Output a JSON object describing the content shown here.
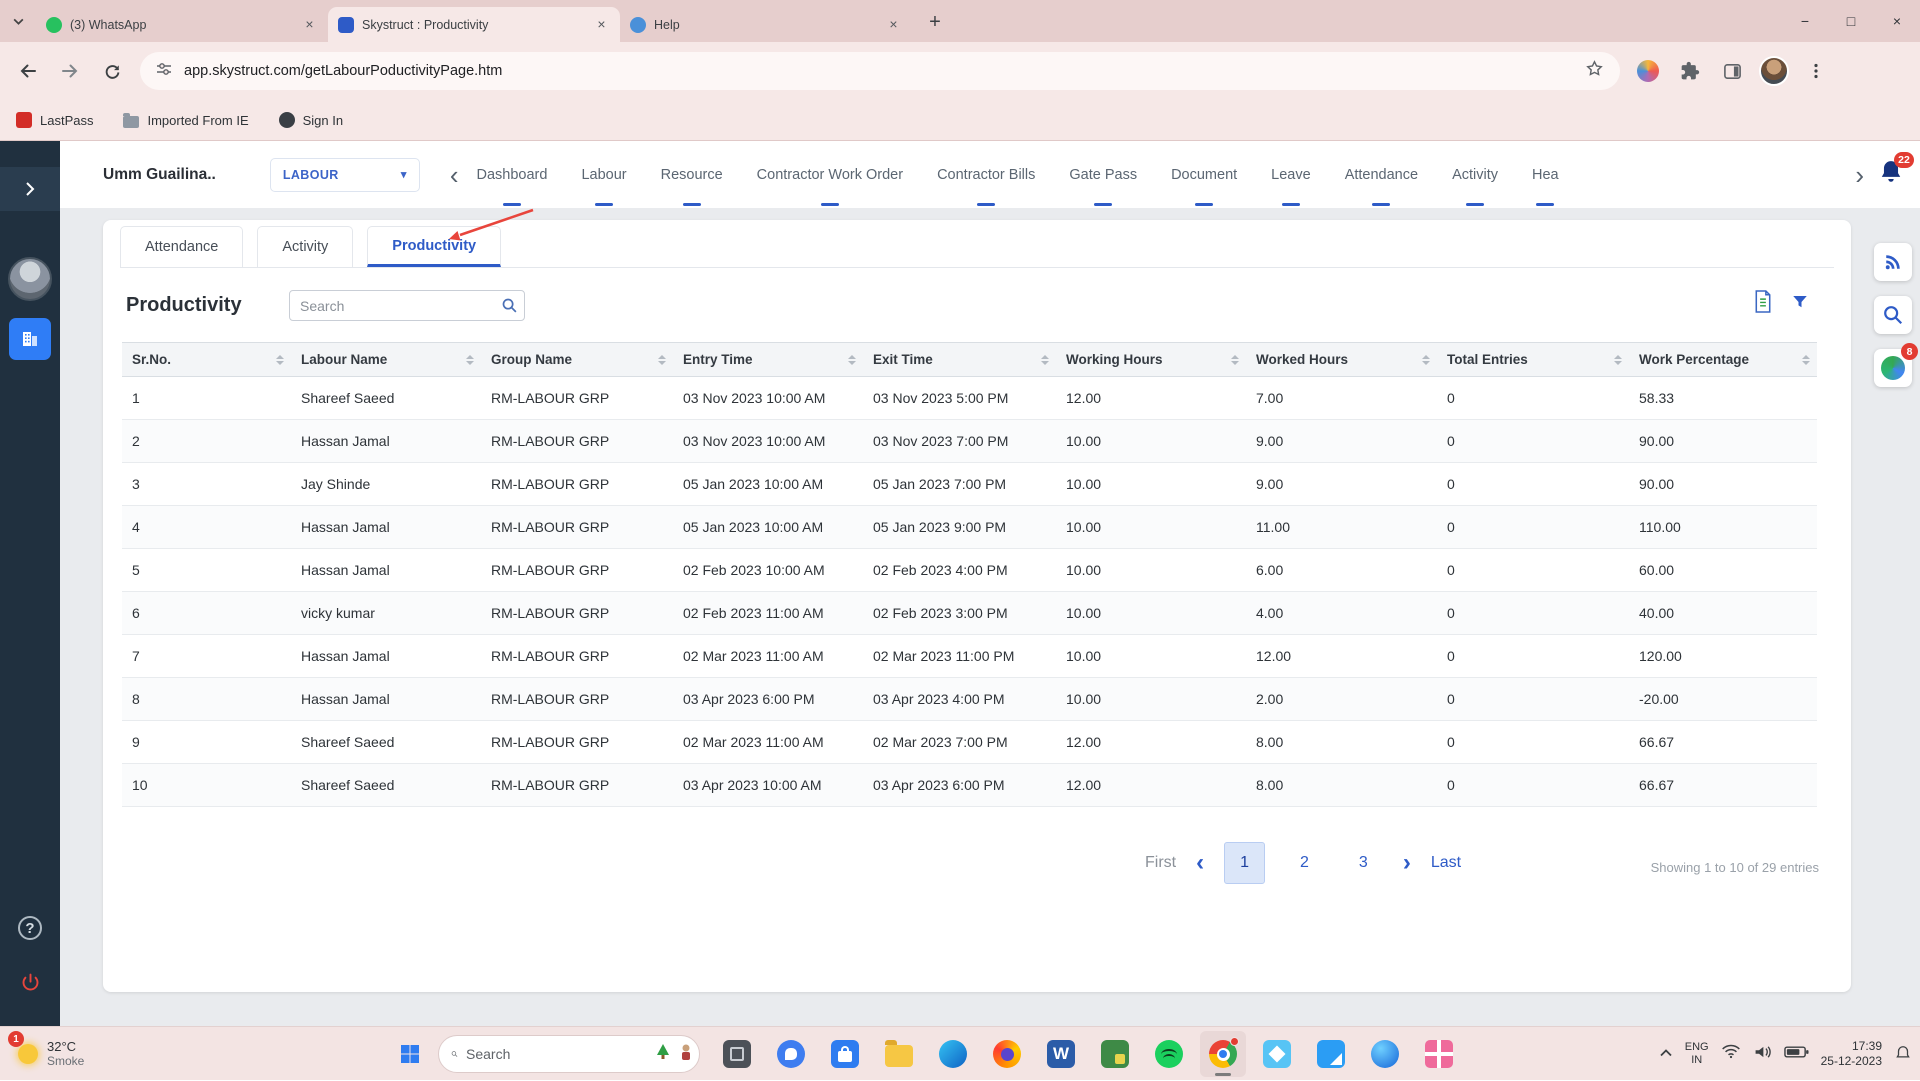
{
  "browser": {
    "tabs": [
      {
        "title": "(3) WhatsApp",
        "kind": "whatsapp",
        "active": false
      },
      {
        "title": "Skystruct : Productivity",
        "kind": "skystruct",
        "active": true
      },
      {
        "title": "Help",
        "kind": "help",
        "active": false
      }
    ],
    "url": "app.skystruct.com/getLabourPoductivityPage.htm",
    "bookmarks": [
      {
        "label": "LastPass",
        "kind": "lastpass"
      },
      {
        "label": "Imported From IE",
        "kind": "folder"
      },
      {
        "label": "Sign In",
        "kind": "globe"
      }
    ]
  },
  "app": {
    "project_name": "Umm Guailina..",
    "module_select": "LABOUR",
    "nav_items": [
      "Dashboard",
      "Labour",
      "Resource",
      "Contractor Work Order",
      "Contractor Bills",
      "Gate Pass",
      "Document",
      "Leave",
      "Attendance",
      "Activity",
      "Hea"
    ],
    "notification_badge": "22",
    "side_search_badge": "8"
  },
  "content": {
    "tabs": [
      {
        "label": "Attendance",
        "active": false
      },
      {
        "label": "Activity",
        "active": false
      },
      {
        "label": "Productivity",
        "active": true
      }
    ],
    "title": "Productivity",
    "search_placeholder": "Search",
    "table": {
      "headers": [
        "Sr.No.",
        "Labour Name",
        "Group Name",
        "Entry Time",
        "Exit Time",
        "Working Hours",
        "Worked Hours",
        "Total Entries",
        "Work Percentage"
      ],
      "rows": [
        [
          "1",
          "Shareef Saeed",
          "RM-LABOUR GRP",
          "03 Nov 2023 10:00 AM",
          "03 Nov 2023 5:00 PM",
          "12.00",
          "7.00",
          "0",
          "58.33"
        ],
        [
          "2",
          "Hassan Jamal",
          "RM-LABOUR GRP",
          "03 Nov 2023 10:00 AM",
          "03 Nov 2023 7:00 PM",
          "10.00",
          "9.00",
          "0",
          "90.00"
        ],
        [
          "3",
          "Jay Shinde",
          "RM-LABOUR GRP",
          "05 Jan 2023 10:00 AM",
          "05 Jan 2023 7:00 PM",
          "10.00",
          "9.00",
          "0",
          "90.00"
        ],
        [
          "4",
          "Hassan Jamal",
          "RM-LABOUR GRP",
          "05 Jan 2023 10:00 AM",
          "05 Jan 2023 9:00 PM",
          "10.00",
          "11.00",
          "0",
          "110.00"
        ],
        [
          "5",
          "Hassan Jamal",
          "RM-LABOUR GRP",
          "02 Feb 2023 10:00 AM",
          "02 Feb 2023 4:00 PM",
          "10.00",
          "6.00",
          "0",
          "60.00"
        ],
        [
          "6",
          "vicky kumar",
          "RM-LABOUR GRP",
          "02 Feb 2023 11:00 AM",
          "02 Feb 2023 3:00 PM",
          "10.00",
          "4.00",
          "0",
          "40.00"
        ],
        [
          "7",
          "Hassan Jamal",
          "RM-LABOUR GRP",
          "02 Mar 2023 11:00 AM",
          "02 Mar 2023 11:00 PM",
          "10.00",
          "12.00",
          "0",
          "120.00"
        ],
        [
          "8",
          "Hassan Jamal",
          "RM-LABOUR GRP",
          "03 Apr 2023 6:00 PM",
          "03 Apr 2023 4:00 PM",
          "10.00",
          "2.00",
          "0",
          "-20.00"
        ],
        [
          "9",
          "Shareef Saeed",
          "RM-LABOUR GRP",
          "02 Mar 2023 11:00 AM",
          "02 Mar 2023 7:00 PM",
          "12.00",
          "8.00",
          "0",
          "66.67"
        ],
        [
          "10",
          "Shareef Saeed",
          "RM-LABOUR GRP",
          "03 Apr 2023 10:00 AM",
          "03 Apr 2023 6:00 PM",
          "12.00",
          "8.00",
          "0",
          "66.67"
        ]
      ]
    },
    "pagination": {
      "first_label": "First",
      "pages": [
        "1",
        "2",
        "3"
      ],
      "active_page": "1",
      "last_label": "Last",
      "info": "Showing 1 to 10 of 29 entries"
    }
  },
  "taskbar": {
    "weather": {
      "badge": "1",
      "temp": "32°C",
      "desc": "Smoke"
    },
    "search_placeholder": "Search",
    "icons": [
      {
        "name": "desktop-window-icon",
        "kind": "window"
      },
      {
        "name": "chat-icon",
        "kind": "chat"
      },
      {
        "name": "microsoft-store-icon",
        "kind": "store"
      },
      {
        "name": "file-explorer-icon",
        "kind": "folder"
      },
      {
        "name": "edge-icon",
        "kind": "edge"
      },
      {
        "name": "firefox-icon",
        "kind": "firefox"
      },
      {
        "name": "word-icon",
        "kind": "word",
        "glyph": "W"
      },
      {
        "name": "green-app-icon",
        "kind": "green"
      },
      {
        "name": "spotify-icon",
        "kind": "spotify"
      },
      {
        "name": "chrome-icon",
        "kind": "chrome",
        "active": true,
        "dot": true
      },
      {
        "name": "photos-icon",
        "kind": "photos"
      },
      {
        "name": "vscode-icon",
        "kind": "vscode"
      },
      {
        "name": "blue-app-icon",
        "kind": "blue"
      },
      {
        "name": "gift-icon",
        "kind": "gift"
      }
    ],
    "tray": {
      "lang": "ENG",
      "region": "IN",
      "time": "17:39",
      "date": "25-12-2023"
    }
  },
  "colors": {
    "accent": "#2e5bc7",
    "annotation": "#e8453c",
    "sidebar": "#20303f"
  }
}
